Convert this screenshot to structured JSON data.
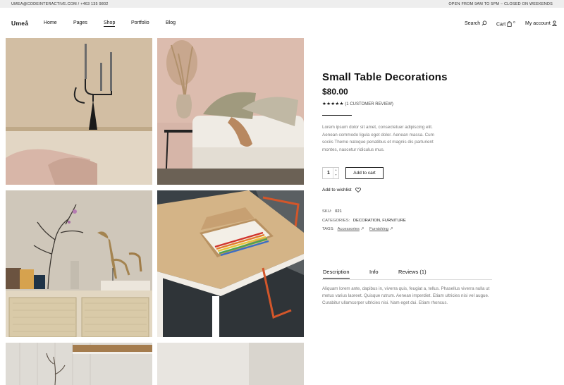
{
  "topbar": {
    "contact": "UMEA@CODEINTERACTIVE.COM / +463 135 9802",
    "hours": "OPEN FROM 9AM TO 5PM – CLOSED ON WEEKENDS"
  },
  "header": {
    "logo": "Umeå",
    "menu": [
      "Home",
      "Pages",
      "Shop",
      "Portfolio",
      "Blog"
    ],
    "active_menu": "Shop",
    "search_label": "Search",
    "cart_label": "Cart",
    "cart_count": "0",
    "account_label": "My account"
  },
  "product": {
    "title": "Small Table Decorations",
    "price": "$80.00",
    "stars": "★★★★★",
    "review_count": "(1 CUSTOMER REVIEW)",
    "description": "Lorem ipsum dolor sit amet, consectetuer adipiscing elit. Aenean commodo ligula eget dolor. Aenean massa. Cum sociis Theme natoque penatibus et magnis dis parturient montes, nascetur ridiculus mus.",
    "quantity": "1",
    "add_to_cart": "Add to cart",
    "wishlist": "Add to wishlist",
    "sku_label": "SKU:",
    "sku": "021",
    "categories_label": "CATEGORIES:",
    "categories": "DECORATION, FURNITURE",
    "tags_label": "TAGS:",
    "tag1": "Accessories",
    "tag2": "Furnishing"
  },
  "tabs": {
    "items": [
      "Description",
      "Info",
      "Reviews (1)"
    ],
    "active": "Description",
    "description_text": "Aliquam lorem ante, dapibus in, viverra quis, feugiat a, tellus. Phasellus viverra nulla ut metus varius laoreet. Quisque rutrum. Aenean imperdiet. Etiam ultricies nisi vel augue. Curabitur ullamcorper ultricies nisi. Nam eget dui. Etiam rhoncus."
  },
  "gallery": {
    "images": [
      "candle-holder-photo",
      "pampas-sofa-photo",
      "sideboard-birds-photo",
      "table-pencils-photo",
      "branch-photo",
      "wall-photo"
    ]
  },
  "colors": {
    "topbar_bg": "#eeeeee",
    "text": "#111111",
    "muted": "#777777"
  }
}
